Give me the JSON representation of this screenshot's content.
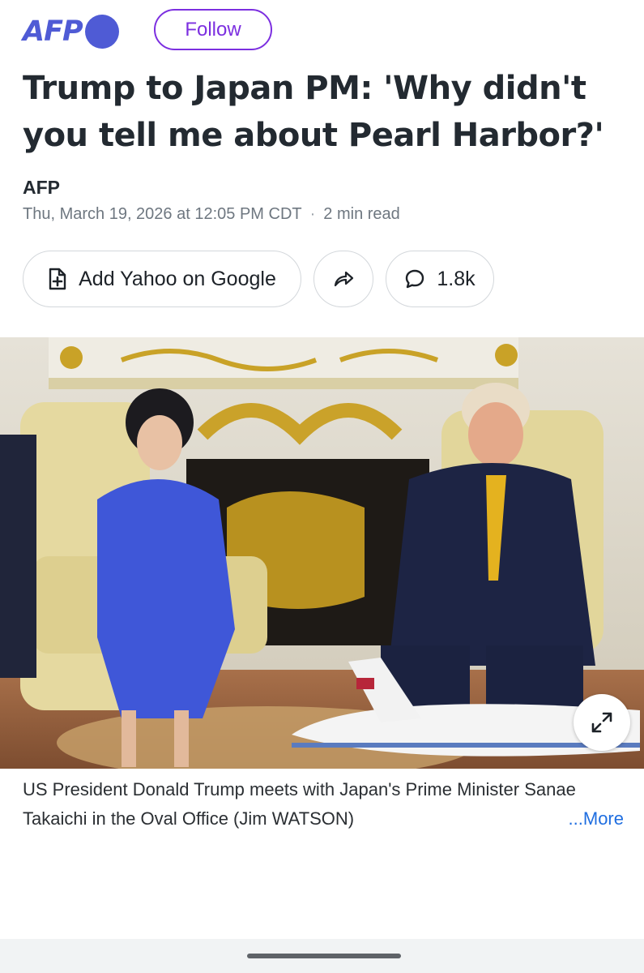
{
  "header": {
    "logo_text": "AFP",
    "follow_label": "Follow",
    "brand_color": "#4f5bd5",
    "follow_color": "#7c2fe0"
  },
  "article": {
    "headline": "Trump to Japan PM: 'Why didn't you tell me about Pearl Harbor?'",
    "author": "AFP",
    "date": "Thu, March 19, 2026 at 12:05 PM CDT",
    "separator": "·",
    "read_time": "2 min read"
  },
  "actions": {
    "add_google_label": "Add Yahoo on Google",
    "add_google_icon": "add-document-icon",
    "share_icon": "share-arrow-icon",
    "comment_icon": "comment-bubble-icon",
    "comments_count": "1.8k"
  },
  "image": {
    "expand_icon": "expand-arrows-icon"
  },
  "caption": {
    "text": "US President Donald Trump meets with Japan's Prime Minister Sanae Takaichi in the Oval Office (Jim WATSON)",
    "more_label": "...More",
    "link_color": "#1f6ee0"
  }
}
